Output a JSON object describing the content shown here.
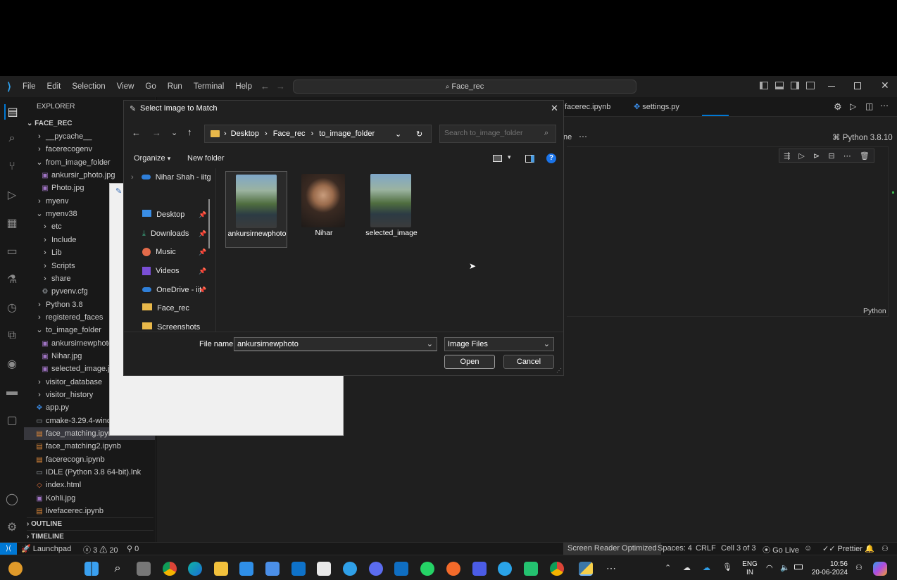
{
  "titlebar": {
    "menu": [
      "File",
      "Edit",
      "Selection",
      "View",
      "Go",
      "Run",
      "Terminal",
      "Help"
    ],
    "search": "Face_rec"
  },
  "sidebar": {
    "title": "EXPLORER",
    "root": "FACE_REC",
    "items": [
      {
        "label": "__pycache__",
        "kind": "folder",
        "open": false,
        "level": 1
      },
      {
        "label": "facerecogenv",
        "kind": "folder",
        "open": false,
        "level": 1
      },
      {
        "label": "from_image_folder",
        "kind": "folder",
        "open": true,
        "level": 1
      },
      {
        "label": "ankursir_photo.jpg",
        "kind": "image",
        "level": 2
      },
      {
        "label": "Photo.jpg",
        "kind": "image",
        "level": 2
      },
      {
        "label": "myenv",
        "kind": "folder",
        "open": false,
        "level": 1
      },
      {
        "label": "myenv38",
        "kind": "folder",
        "open": true,
        "level": 1
      },
      {
        "label": "etc",
        "kind": "folder",
        "open": false,
        "level": 2
      },
      {
        "label": "Include",
        "kind": "folder",
        "open": false,
        "level": 2
      },
      {
        "label": "Lib",
        "kind": "folder",
        "open": false,
        "level": 2
      },
      {
        "label": "Scripts",
        "kind": "folder",
        "open": false,
        "level": 2
      },
      {
        "label": "share",
        "kind": "folder",
        "open": false,
        "level": 2
      },
      {
        "label": "pyvenv.cfg",
        "kind": "config",
        "level": 2
      },
      {
        "label": "Python 3.8",
        "kind": "folder",
        "open": false,
        "level": 1
      },
      {
        "label": "registered_faces",
        "kind": "folder",
        "open": false,
        "level": 1
      },
      {
        "label": "to_image_folder",
        "kind": "folder",
        "open": true,
        "level": 1
      },
      {
        "label": "ankursirnewphoto",
        "kind": "image",
        "level": 2
      },
      {
        "label": "Nihar.jpg",
        "kind": "image",
        "level": 2
      },
      {
        "label": "selected_image.jp",
        "kind": "image",
        "level": 2
      },
      {
        "label": "visitor_database",
        "kind": "folder",
        "open": false,
        "level": 1
      },
      {
        "label": "visitor_history",
        "kind": "folder",
        "open": false,
        "level": 1
      },
      {
        "label": "app.py",
        "kind": "python",
        "level": 1
      },
      {
        "label": "cmake-3.29.4-wind",
        "kind": "file",
        "level": 1
      },
      {
        "label": "face_matching.ipyn",
        "kind": "notebook",
        "level": 1,
        "selected": true
      },
      {
        "label": "face_matching2.ipynb",
        "kind": "notebook",
        "level": 1
      },
      {
        "label": "facerecogn.ipynb",
        "kind": "notebook",
        "level": 1
      },
      {
        "label": "IDLE (Python 3.8 64-bit).lnk",
        "kind": "file",
        "level": 1
      },
      {
        "label": "index.html",
        "kind": "html",
        "level": 1
      },
      {
        "label": "Kohli.jpg",
        "kind": "image",
        "level": 1
      },
      {
        "label": "livefacerec.ipynb",
        "kind": "notebook",
        "level": 1
      }
    ],
    "outline": "OUTLINE",
    "timeline": "TIMELINE"
  },
  "editor": {
    "tabs": [
      "facerec.ipynb",
      "settings.py"
    ],
    "partial_tab": "ne",
    "kernel": "Python 3.8.10",
    "cell_language": "Python"
  },
  "dialog": {
    "title": "Select Image to Match",
    "breadcrumb": [
      "Desktop",
      "Face_rec",
      "to_image_folder"
    ],
    "search_placeholder": "Search to_image_folder",
    "organize": "Organize",
    "new_folder": "New folder",
    "nav": [
      {
        "label": "Nihar Shah - iitg",
        "icon": "onedrive"
      },
      {
        "label": "Desktop",
        "icon": "desktop",
        "pinned": true
      },
      {
        "label": "Downloads",
        "icon": "downloads",
        "pinned": true
      },
      {
        "label": "Music",
        "icon": "music",
        "pinned": true
      },
      {
        "label": "Videos",
        "icon": "videos",
        "pinned": true
      },
      {
        "label": "OneDrive - iit",
        "icon": "onedrive",
        "pinned": true
      },
      {
        "label": "Face_rec",
        "icon": "folder"
      },
      {
        "label": "Screenshots",
        "icon": "folder"
      }
    ],
    "files": [
      {
        "name": "ankursirnewphoto",
        "selected": true
      },
      {
        "name": "Nihar",
        "selected": false
      },
      {
        "name": "selected_image",
        "selected": false
      }
    ],
    "file_name_label": "File name:",
    "file_name_value": "ankursirnewphoto",
    "file_type": "Image Files",
    "open": "Open",
    "cancel": "Cancel"
  },
  "statusbar": {
    "launchpad": "Launchpad",
    "errors": "3",
    "warnings": "20",
    "ports": "0",
    "screen_reader": "Screen Reader Optimized",
    "spaces": "Spaces: 4",
    "eol": "CRLF",
    "cell": "Cell 3 of 3",
    "golive": "Go Live",
    "prettier": "Prettier"
  },
  "taskbar": {
    "lang1": "ENG",
    "lang2": "IN",
    "time": "10:56",
    "date": "20-06-2024"
  },
  "colors": {
    "accent": "#0078d4",
    "status_blue": "#0078d4",
    "sidebar_bg": "#181818",
    "editor_bg": "#1f1f1f"
  }
}
